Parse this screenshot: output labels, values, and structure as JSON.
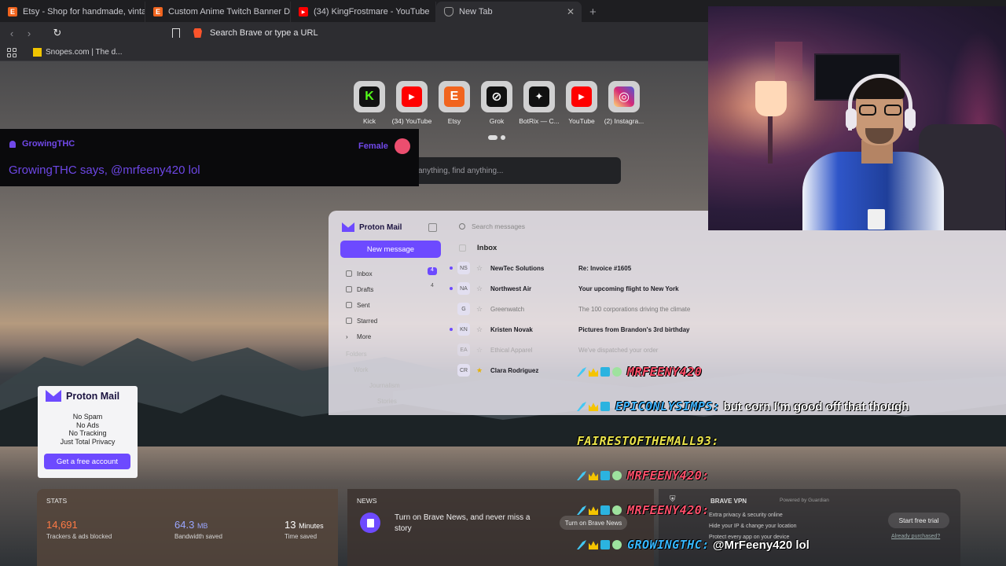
{
  "tabs": [
    {
      "title": "Etsy - Shop for handmade, vintage, c",
      "favicon": "E",
      "color": "#f1641e"
    },
    {
      "title": "Custom Anime Twitch Banner Design",
      "favicon": "E",
      "color": "#f1641e"
    },
    {
      "title": "(34) KingFrostmare - YouTube",
      "favicon": "▶",
      "color": "#ff0000"
    },
    {
      "title": "New Tab",
      "favicon": "brave-shield-icon",
      "color": "#777777",
      "active": true
    }
  ],
  "address_bar": {
    "placeholder": "Search Brave or type a URL"
  },
  "bookmarks": [
    {
      "label": "Snopes.com | The d..."
    }
  ],
  "top_sites": [
    {
      "label": "Kick",
      "icon": "K",
      "bg": "#111111",
      "fg": "#53fc18"
    },
    {
      "label": "(34) YouTube",
      "icon": "▶",
      "bg": "#ff0000",
      "fg": "#ffffff"
    },
    {
      "label": "Etsy",
      "icon": "E",
      "bg": "#f1641e",
      "fg": "#ffffff"
    },
    {
      "label": "Grok",
      "icon": "⊘",
      "bg": "#111111",
      "fg": "#ffffff"
    },
    {
      "label": "BotRix — C...",
      "icon": "✦",
      "bg": "#111111",
      "fg": "#ffffff"
    },
    {
      "label": "YouTube",
      "icon": "▶",
      "bg": "#ff0000",
      "fg": "#ffffff"
    },
    {
      "label": "(2) Instagra...",
      "icon": "◎",
      "bg": "#d62976",
      "fg": "#ffffff"
    }
  ],
  "search": {
    "placeholder": "anything, find anything..."
  },
  "notification": {
    "user": "GrowingTHC",
    "gender": "Female",
    "message": "GrowingTHC says, @mrfeeny420 lol"
  },
  "proton_mail": {
    "brand": "Proton Mail",
    "new_message": "New message",
    "search_placeholder": "Search messages",
    "inbox_title": "Inbox",
    "folders": [
      {
        "label": "Inbox",
        "count": "4"
      },
      {
        "label": "Drafts",
        "count": "4"
      },
      {
        "label": "Sent"
      },
      {
        "label": "Starred"
      },
      {
        "label": "More"
      }
    ],
    "folders_faded": [
      "Folders",
      "Work",
      "Journalism",
      "Stories"
    ],
    "rows": [
      {
        "avatar": "NS",
        "from": "NewTec Solutions",
        "subject": "Re: Invoice #1605",
        "unread": true
      },
      {
        "avatar": "NA",
        "from": "Northwest Air",
        "subject": "Your upcoming flight to New York",
        "unread": true
      },
      {
        "avatar": "G",
        "from": "Greenwatch",
        "subject": "The 100 corporations driving the climate",
        "unread": false
      },
      {
        "avatar": "KN",
        "from": "Kristen Novak",
        "subject": "Pictures from Brandon's 3rd birthday",
        "unread": true
      },
      {
        "avatar": "EA",
        "from": "Ethical Apparel",
        "subject": "We've dispatched your order",
        "unread": false
      },
      {
        "avatar": "CR",
        "from": "Clara Rodriguez",
        "subject": "",
        "unread": false,
        "starred": true
      }
    ],
    "card_lines": [
      "No Spam",
      "No Ads",
      "No Tracking",
      "Just Total Privacy"
    ],
    "card_cta": "Get a free account"
  },
  "stats": {
    "title": "STATS",
    "items": [
      {
        "value": "14,691",
        "unit": "",
        "desc": "Trackers & ads blocked",
        "color": "#ff7a45"
      },
      {
        "value": "64.3",
        "unit": "MB",
        "desc": "Bandwidth saved",
        "color": "#9aa6ff"
      },
      {
        "value": "13",
        "unit": "Minutes",
        "desc": "Time saved",
        "color": "#ffffff"
      }
    ]
  },
  "news": {
    "title": "NEWS",
    "text": "Turn on Brave News, and never miss a story",
    "button": "Turn on Brave News"
  },
  "vpn": {
    "title": "BRAVE VPN",
    "powered": "Powered by Guardian",
    "lines": [
      "Extra privacy & security online",
      "Hide your IP & change your location",
      "Protect every app on your device"
    ],
    "cta": "Start free trial",
    "purchased": "Already purchased?"
  },
  "chat": [
    {
      "user": "MRFEENY420",
      "text": "",
      "color": "#ff4f6a"
    },
    {
      "user": "EPICONLYSIMPS:",
      "text": "but corn I'm good off that though",
      "color": "#3fb4ff"
    },
    {
      "user": "FAIRESTOFTHEMALL93:",
      "text": "",
      "color": "#e8e24a"
    },
    {
      "user": "MRFEENY420:",
      "text": "",
      "color": "#ff4f6a"
    },
    {
      "user": "MRFEENY420:",
      "text": "",
      "color": "#ff4f6a"
    },
    {
      "user": "GROWINGTHC:",
      "text": "@MrFeeny420 lol",
      "color": "#36b7ff"
    }
  ]
}
